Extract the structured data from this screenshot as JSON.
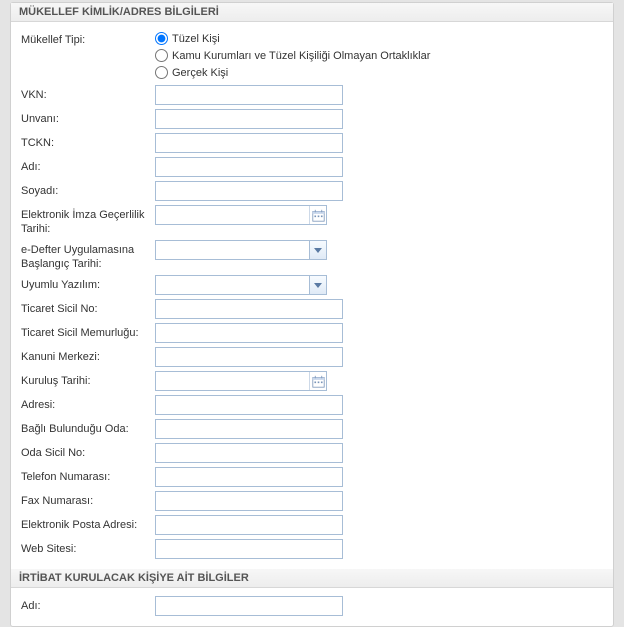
{
  "section1": {
    "title": "MÜKELLEF KİMLİK/ADRES BİLGİLERİ",
    "mukellefTipiLabel": "Mükellef Tipi:",
    "radios": {
      "tuzel": "Tüzel Kişi",
      "kamu": "Kamu Kurumları ve Tüzel Kişiliği Olmayan Ortaklıklar",
      "gercek": "Gerçek Kişi"
    },
    "fields": {
      "vkn": "VKN:",
      "unvani": "Unvanı:",
      "tckn": "TCKN:",
      "adi": "Adı:",
      "soyadi": "Soyadı:",
      "eimza": "Elektronik İmza Geçerlilik Tarihi:",
      "edefter": "e-Defter Uygulamasına Başlangıç Tarihi:",
      "uyumlu": "Uyumlu Yazılım:",
      "tsicilno": "Ticaret Sicil No:",
      "tsicilmem": "Ticaret Sicil Memurluğu:",
      "kanuni": "Kanuni Merkezi:",
      "kurulus": "Kuruluş Tarihi:",
      "adres": "Adresi:",
      "oda": "Bağlı Bulunduğu Oda:",
      "odano": "Oda Sicil No:",
      "tel": "Telefon Numarası:",
      "fax": "Fax Numarası:",
      "eposta": "Elektronik Posta Adresi:",
      "web": "Web Sitesi:"
    },
    "values": {
      "vkn": "",
      "unvani": "",
      "tckn": "",
      "adi": "",
      "soyadi": "",
      "eimza": "",
      "edefter": "",
      "uyumlu": "",
      "tsicilno": "",
      "tsicilmem": "",
      "kanuni": "",
      "kurulus": "",
      "adres": "",
      "oda": "",
      "odano": "",
      "tel": "",
      "fax": "",
      "eposta": "",
      "web": ""
    }
  },
  "section2": {
    "title": "İRTİBAT KURULACAK KİŞİYE AİT BİLGİLER",
    "fields": {
      "adi": "Adı:"
    },
    "values": {
      "adi": ""
    }
  }
}
